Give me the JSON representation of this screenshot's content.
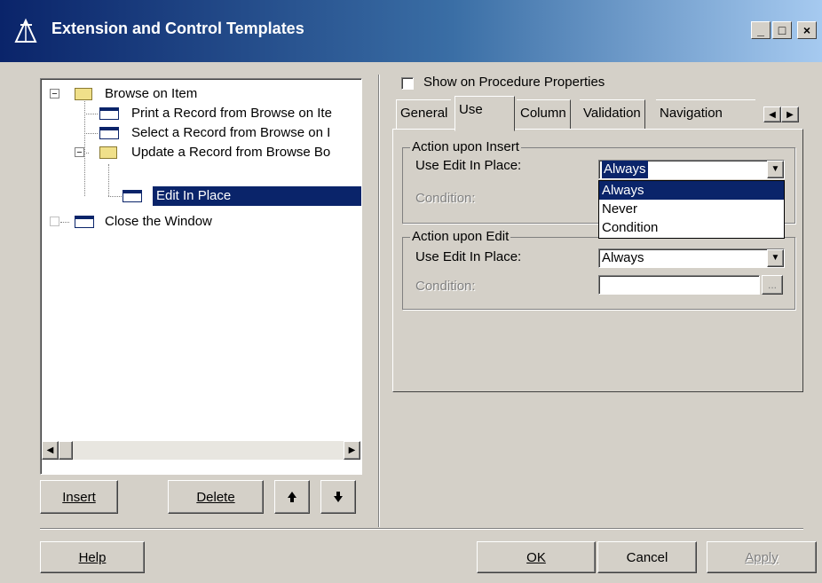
{
  "window": {
    "title": "Extension and Control Templates",
    "controls": {
      "minimize": "_",
      "maximize": "□",
      "close": "×"
    }
  },
  "tree": {
    "items": [
      {
        "label": "Browse on Item",
        "icon": "folder-icon",
        "expander": "−"
      },
      {
        "label": "Print a Record from Browse on Ite",
        "icon": "window-icon"
      },
      {
        "label": "Select a Record from Browse on I",
        "icon": "window-icon"
      },
      {
        "label": "Update a Record from Browse Bo",
        "icon": "folder-icon",
        "expander": "−"
      },
      {
        "label": "Edit In Place",
        "icon": "window-icon",
        "selected": true
      },
      {
        "label": "Close the Window",
        "icon": "window-icon"
      }
    ]
  },
  "buttons": {
    "insert": "Insert",
    "delete": "Delete",
    "help": "Help",
    "ok": "OK",
    "cancel": "Cancel",
    "apply": "Apply"
  },
  "show_on_properties": {
    "label": "Show on Procedure Properties",
    "checked": false
  },
  "tabs": [
    {
      "label": "General"
    },
    {
      "label": "Use",
      "active": true
    },
    {
      "label": "Column"
    },
    {
      "label": "Validation"
    },
    {
      "label": "Navigation"
    }
  ],
  "insert_group": {
    "title": "Action upon Insert",
    "use_label": "Use Edit In Place:",
    "use_value": "Always",
    "condition_label": "Condition:"
  },
  "dropdown_options": [
    "Always",
    "Never",
    "Condition"
  ],
  "edit_group": {
    "title": "Action upon Edit",
    "use_label": "Use Edit In Place:",
    "use_value": "Always",
    "condition_label": "Condition:",
    "ellipsis": "..."
  },
  "colors": {
    "selection": "#0a246a",
    "title_start": "#0a246a",
    "title_end": "#a6caf0",
    "face": "#d4d0c8"
  }
}
